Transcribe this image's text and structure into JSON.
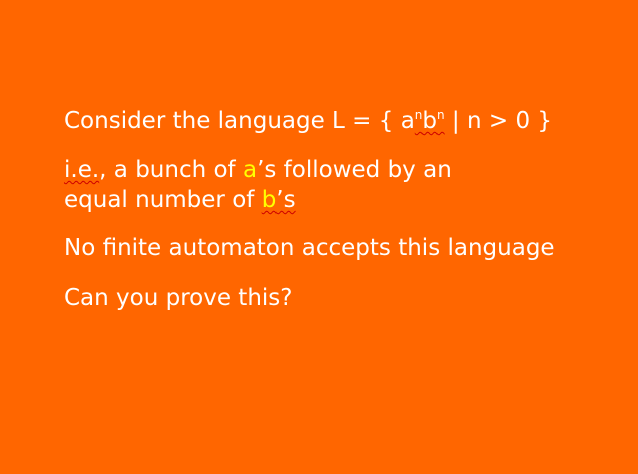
{
  "slide": {
    "line1": {
      "prefix": "Consider the language L = { a",
      "sup1": "n",
      "mid": "b",
      "sup2": "n",
      "suffix": " | n > 0 }"
    },
    "line2": {
      "ie": "i.e.",
      "part1": ", a bunch of ",
      "highlight_a": "a",
      "part2": "’s followed by an"
    },
    "line3": {
      "part1": "equal number of ",
      "highlight_b": "b",
      "part2": "’s"
    },
    "line4": "No finite automaton accepts this language",
    "line5": "Can you prove this?"
  },
  "colors": {
    "background": "#ff6600",
    "text": "#ffffff",
    "highlight": "#ffff00",
    "spellcheck_underline": "#cc0000"
  }
}
